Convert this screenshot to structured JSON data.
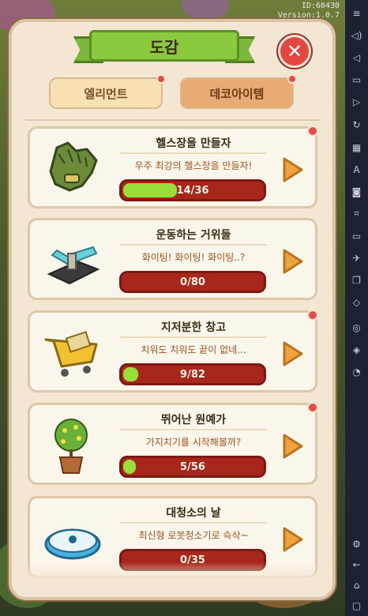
{
  "overlay": {
    "id_text": "ID:60430",
    "version_text": "Version:1.0.7"
  },
  "dialog": {
    "title": "도감",
    "close_icon": "close-icon"
  },
  "tabs": [
    {
      "label": "엘리먼트",
      "has_notice": true,
      "active": false
    },
    {
      "label": "데코아이템",
      "has_notice": true,
      "active": true
    }
  ],
  "cards": [
    {
      "title": "헬스장을 만들자",
      "desc": "우주 최강의 헬스장을 만들자!",
      "progress": "14/36",
      "progress_fraction": 0.389,
      "icon": "glove-icon",
      "has_notice": true
    },
    {
      "title": "운동하는 거위들",
      "desc": "화이팅! 화이팅! 화이팅..?",
      "progress": "0/80",
      "progress_fraction": 0.0,
      "icon": "bench-press-icon",
      "has_notice": false
    },
    {
      "title": "지저분한 창고",
      "desc": "치워도 치워도 끝이 없네...",
      "progress": "9/82",
      "progress_fraction": 0.11,
      "icon": "shopping-cart-icon",
      "has_notice": true
    },
    {
      "title": "뛰어난 원예가",
      "desc": "가지치기를 시작해볼까?",
      "progress": "5/56",
      "progress_fraction": 0.089,
      "icon": "potted-tree-icon",
      "has_notice": true
    },
    {
      "title": "대청소의 날",
      "desc": "최신형 로봇청소기로 슥삭~",
      "progress": "0/35",
      "progress_fraction": 0.0,
      "icon": "robot-vacuum-icon",
      "has_notice": false
    }
  ],
  "colors": {
    "progress_fill": "#97e03a",
    "progress_bg": "#a8261c",
    "notice_dot": "#e84a4a",
    "arrow": "#f0a33a"
  },
  "emulator_sidebar": {
    "icons": [
      "menu-icon",
      "volume-up-icon",
      "volume-down-icon",
      "video-icon",
      "play-icon",
      "refresh-icon",
      "building-icon",
      "apk-icon",
      "screenshot-icon",
      "crop-icon",
      "folder-icon",
      "airplane-icon",
      "multi-window-icon",
      "eraser-icon",
      "location-icon",
      "layers-icon",
      "speed-icon",
      "settings-icon",
      "back-icon",
      "home-icon",
      "recent-apps-icon"
    ]
  }
}
